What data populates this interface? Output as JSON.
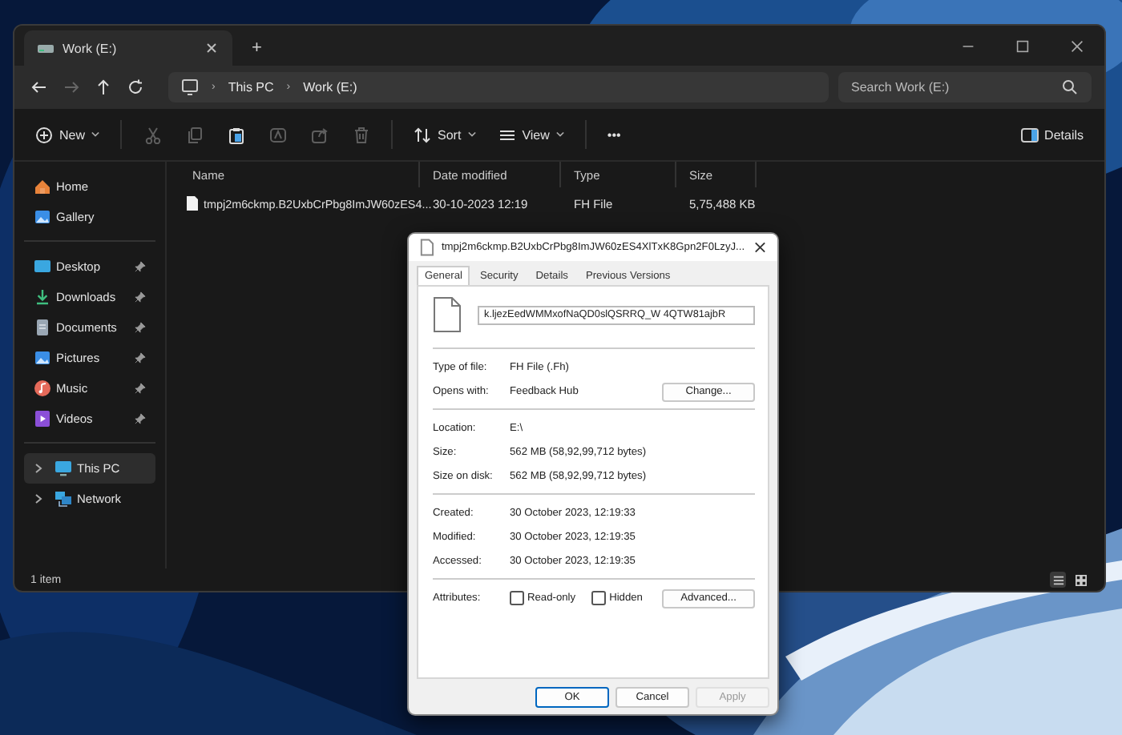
{
  "explorer": {
    "tabs": [
      {
        "label": "Work (E:)",
        "selected": true
      }
    ],
    "new_tab": "+",
    "breadcrumb": {
      "separator": "›",
      "items": [
        "This PC",
        "Work (E:)"
      ]
    },
    "search": {
      "placeholder": "Search Work (E:)"
    },
    "toolbar": {
      "new": "New",
      "icon_buttons": [
        {
          "disabled": true
        },
        {
          "disabled": true
        },
        {
          "disabled": false
        },
        {
          "disabled": true
        },
        {
          "disabled": true
        },
        {
          "disabled": true
        }
      ],
      "sort": "Sort",
      "view": "View",
      "more": "•••",
      "details": "Details"
    },
    "sidebar": [
      {
        "items": [
          {
            "label": "Home",
            "pinned": false,
            "selected": false
          },
          {
            "label": "Gallery",
            "pinned": false,
            "selected": false
          }
        ]
      },
      {
        "items": [
          {
            "label": "Desktop",
            "pinned": true,
            "selected": false
          },
          {
            "label": "Downloads",
            "pinned": true,
            "selected": false
          },
          {
            "label": "Documents",
            "pinned": true,
            "selected": false
          },
          {
            "label": "Pictures",
            "pinned": true,
            "selected": false
          },
          {
            "label": "Music",
            "pinned": true,
            "selected": false
          },
          {
            "label": "Videos",
            "pinned": true,
            "selected": false
          }
        ]
      },
      {
        "items": [
          {
            "label": "This PC",
            "pinned": false,
            "selected": true,
            "expanded": false
          },
          {
            "label": "Network",
            "pinned": false,
            "selected": false,
            "expanded": false
          }
        ]
      }
    ],
    "columns": [
      "Name",
      "Date modified",
      "Type",
      "Size"
    ],
    "rows": [
      {
        "name": "tmpj2m6ckmp.B2UxbCrPbg8ImJW60zES4...",
        "date": "30-10-2023 12:19",
        "type": "FH File",
        "size": "5,75,488 KB",
        "selected": false
      }
    ],
    "status": "1 item",
    "views": [
      {
        "selected": true
      },
      {
        "selected": false
      }
    ]
  },
  "dialog": {
    "title": "tmpj2m6ckmp.B2UxbCrPbg8ImJW60zES4XlTxK8Gpn2F0LzyJ...",
    "tabs": [
      {
        "label": "General",
        "selected": true
      },
      {
        "label": "Security",
        "selected": false
      },
      {
        "label": "Details",
        "selected": false
      },
      {
        "label": "Previous Versions",
        "selected": false
      }
    ],
    "filename": "k.ljezEedWMMxofNaQD0slQSRRQ_W 4QTW81ajbR",
    "sections": [
      [
        {
          "label": "Type of file:",
          "value": "FH File (.Fh)"
        },
        {
          "label": "Opens with:",
          "value": "Feedback Hub",
          "button": "Change..."
        }
      ],
      [
        {
          "label": "Location:",
          "value": "E:\\"
        },
        {
          "label": "Size:",
          "value": "562 MB (58,92,99,712 bytes)"
        },
        {
          "label": "Size on disk:",
          "value": "562 MB (58,92,99,712 bytes)"
        }
      ],
      [
        {
          "label": "Created:",
          "value": "30 October 2023, 12:19:33"
        },
        {
          "label": "Modified:",
          "value": "30 October 2023, 12:19:35"
        },
        {
          "label": "Accessed:",
          "value": "30 October 2023, 12:19:35"
        }
      ]
    ],
    "attributes": {
      "label": "Attributes:",
      "checkboxes": [
        {
          "label": "Read-only",
          "checked": false
        },
        {
          "label": "Hidden",
          "checked": false
        }
      ],
      "button": "Advanced..."
    },
    "buttons": [
      {
        "label": "OK",
        "default": true,
        "disabled": false
      },
      {
        "label": "Cancel",
        "default": false,
        "disabled": false
      },
      {
        "label": "Apply",
        "default": false,
        "disabled": true
      }
    ]
  }
}
